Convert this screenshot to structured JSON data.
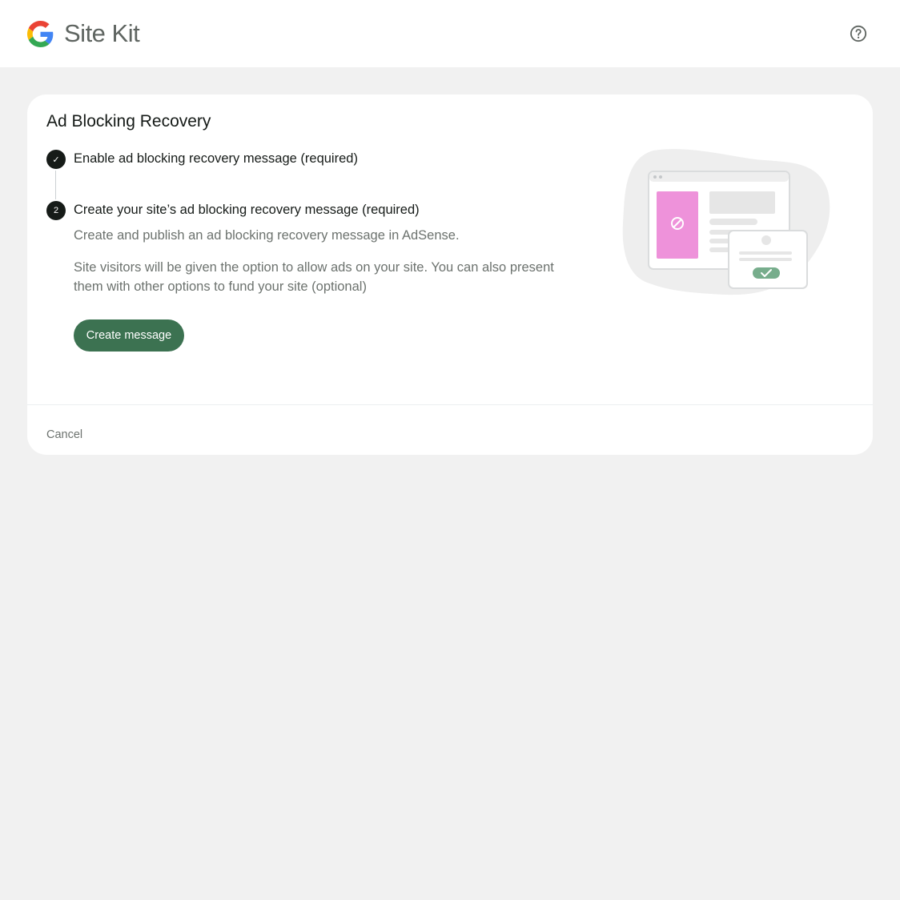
{
  "header": {
    "brand_name": "Site Kit",
    "help_icon": "help-circle-icon"
  },
  "card": {
    "title": "Ad Blocking Recovery",
    "steps": [
      {
        "marker": "✓",
        "marker_icon": "checkmark-icon",
        "title": "Enable ad blocking recovery message (required)",
        "status": "completed"
      },
      {
        "marker": "2",
        "title": "Create your site’s ad blocking recovery message (required)",
        "status": "active",
        "description": [
          "Create and publish an ad blocking recovery message in AdSense.",
          "Site visitors will be given the option to allow ads on your site. You can also present them with other options to fund your site (optional)"
        ],
        "cta_label": "Create message"
      }
    ],
    "cancel_label": "Cancel"
  },
  "colors": {
    "accent": "#3c7251",
    "page_background": "#f1f1f1",
    "card_background": "#ffffff",
    "illustration_pink": "#ee92da",
    "illustration_green": "#77ad8c"
  }
}
